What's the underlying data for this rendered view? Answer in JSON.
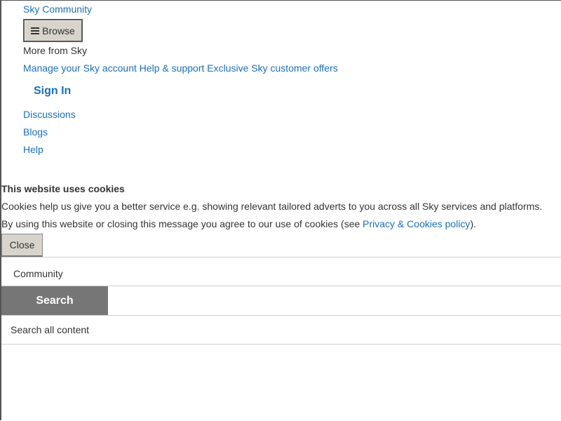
{
  "header": {
    "community_link": "Sky Community",
    "browse_button": "Browse",
    "more_from_sky": "More from Sky",
    "sky_links": [
      "Manage your Sky account",
      "Help & support",
      "Exclusive Sky customer offers"
    ],
    "sign_in": "Sign In"
  },
  "nav": {
    "items": [
      "Discussions",
      "Blogs",
      "Help"
    ]
  },
  "cookie_banner": {
    "title": "This website uses cookies",
    "line1": "Cookies help us give you a better service e.g. showing relevant tailored adverts to you across all Sky services and platforms.",
    "line2_prefix": "By using this website or closing this message you agree to our use of cookies (see ",
    "policy_link": "Privacy & Cookies policy",
    "line2_suffix": ").",
    "close_button": "Close"
  },
  "search_area": {
    "scope_label": "Community",
    "search_button": "Search",
    "input_placeholder": "Search all content"
  },
  "icons": {
    "browse": "menu-icon"
  },
  "colors": {
    "link": "#1a6fb5",
    "search_button_bg": "#767676",
    "button_bg": "#d8d4cc"
  }
}
